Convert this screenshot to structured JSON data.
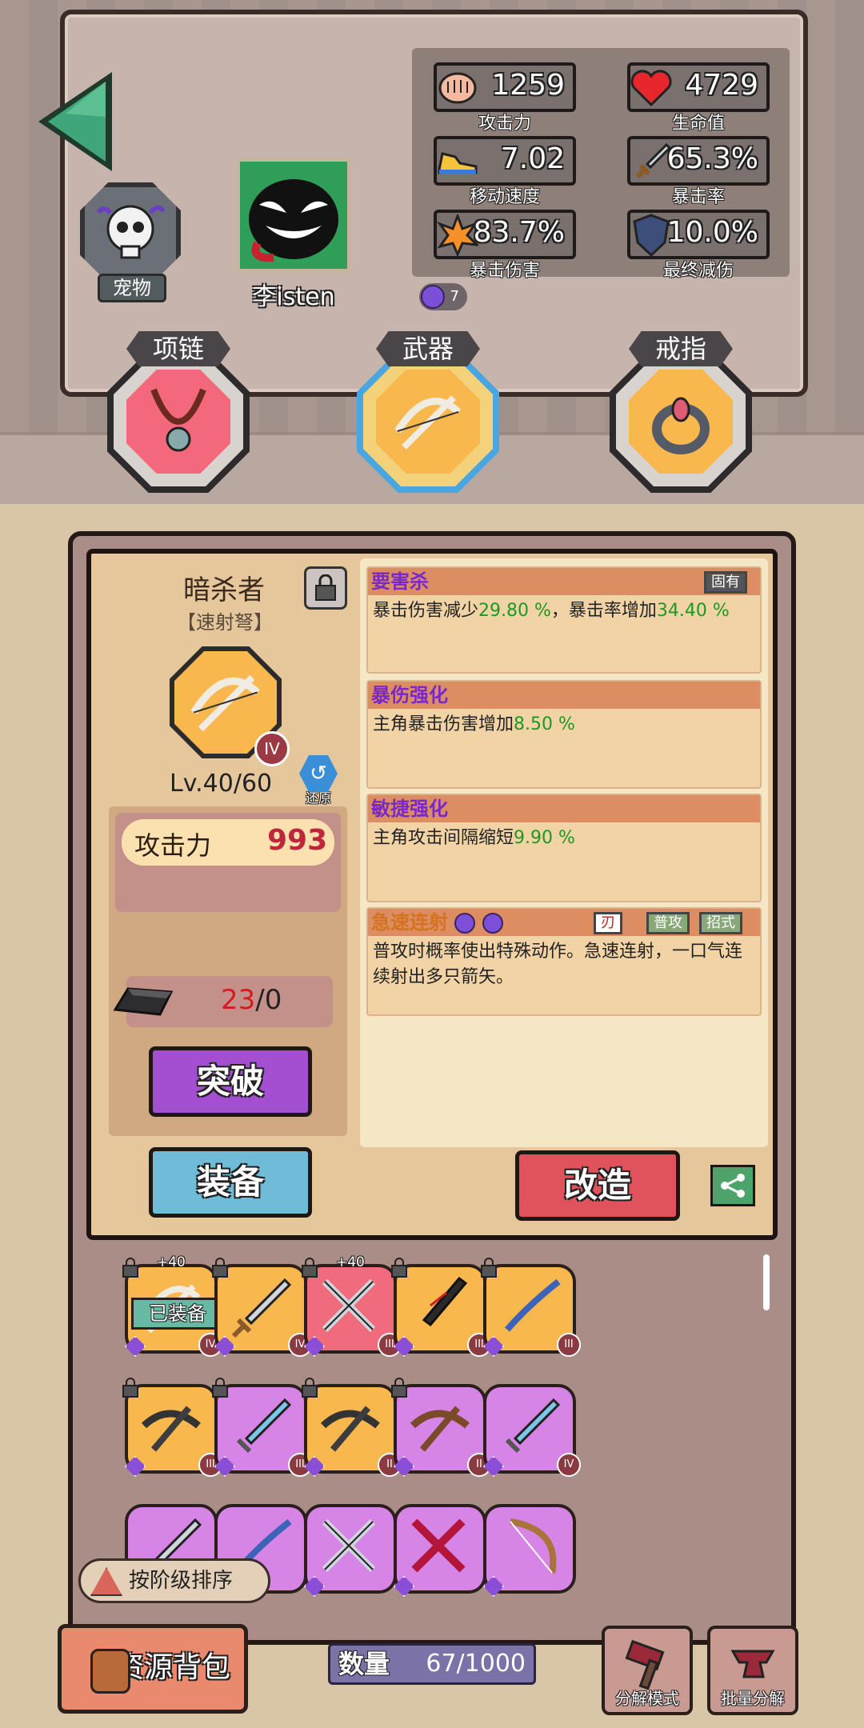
{
  "header": {
    "pet_label": "宠物",
    "player_name": "李isten",
    "energy_count": "7"
  },
  "stats": [
    {
      "name": "攻击力",
      "value": "1259",
      "icon": "fist-icon"
    },
    {
      "name": "生命值",
      "value": "4729",
      "icon": "heart-icon"
    },
    {
      "name": "移动速度",
      "value": "7.02",
      "icon": "sneaker-icon"
    },
    {
      "name": "暴击率",
      "value": "65.3%",
      "icon": "sword-icon"
    },
    {
      "name": "暴击伤害",
      "value": "83.7%",
      "icon": "explosion-icon"
    },
    {
      "name": "最终减伤",
      "value": "10.0%",
      "icon": "shield-icon"
    }
  ],
  "equip_slots": [
    {
      "label": "项链",
      "icon": "necklace-icon"
    },
    {
      "label": "武器",
      "icon": "crossbow-icon",
      "selected": true
    },
    {
      "label": "戒指",
      "icon": "ring-icon"
    }
  ],
  "weapon": {
    "name": "暗杀者",
    "type": "【速射弩】",
    "tier": "IV",
    "level": "Lv.40/60",
    "restore_label": "还原",
    "attack_label": "攻击力",
    "attack_value": "993",
    "material_have": "23",
    "material_sep": "/0",
    "break_label": "突破",
    "equip_label": "装备",
    "forge_label": "改造"
  },
  "affixes": [
    {
      "title": "要害杀",
      "tag": "固有",
      "text_a": "暴击伤害减少",
      "val_a": "29.80 %",
      "text_b": "，暴击率增加",
      "val_b": "34.40 %"
    },
    {
      "title": "暴伤强化",
      "text_a": "主角暴击伤害增加",
      "val_a": "8.50 %"
    },
    {
      "title": "敏捷强化",
      "text_a": "主角攻击间隔缩短",
      "val_a": "9.90 %"
    },
    {
      "title": "急速连射",
      "tags": [
        "刃",
        "普攻",
        "招式"
      ],
      "text_a": "普攻时概率使出特殊动作。急速连射，一口气连续射出多只箭矢。"
    }
  ],
  "inventory": [
    {
      "color": "orange",
      "art": "bone-crossbow",
      "tier": "IV",
      "plus": "+40",
      "locked": true,
      "equipped": "已装备"
    },
    {
      "color": "orange",
      "art": "sword",
      "tier": "IV",
      "locked": true
    },
    {
      "color": "red",
      "art": "crossed-swords",
      "tier": "III",
      "plus": "+40",
      "locked": true
    },
    {
      "color": "orange",
      "art": "dark-blade",
      "tier": "III",
      "locked": true
    },
    {
      "color": "orange",
      "art": "katana",
      "tier": "III",
      "locked": true
    },
    {
      "color": "orange",
      "art": "crossbow",
      "tier": "III",
      "locked": true
    },
    {
      "color": "purple",
      "art": "ice-sword",
      "tier": "III",
      "locked": true
    },
    {
      "color": "orange",
      "art": "crossbow",
      "tier": "II",
      "locked": true
    },
    {
      "color": "purple",
      "art": "wood-crossbow",
      "tier": "II",
      "locked": true
    },
    {
      "color": "purple",
      "art": "ice-sword",
      "tier": "IV"
    },
    {
      "color": "purple",
      "art": "sword"
    },
    {
      "color": "purple",
      "art": "katana"
    },
    {
      "color": "purple",
      "art": "crossed-swords"
    },
    {
      "color": "purple",
      "art": "crossed-swords-red"
    },
    {
      "color": "purple",
      "art": "bow"
    }
  ],
  "sort_label": "按阶级排序",
  "bottom": {
    "resource_label": "资源背包",
    "qty_label": "数量",
    "qty_value": "67/1000",
    "salvage_mode": "分解模式",
    "batch_salvage": "批量分解"
  },
  "colors": {
    "attack_red": "#c0263b",
    "affix_green": "#1a9a24",
    "affix_purple": "#7a28c8"
  }
}
